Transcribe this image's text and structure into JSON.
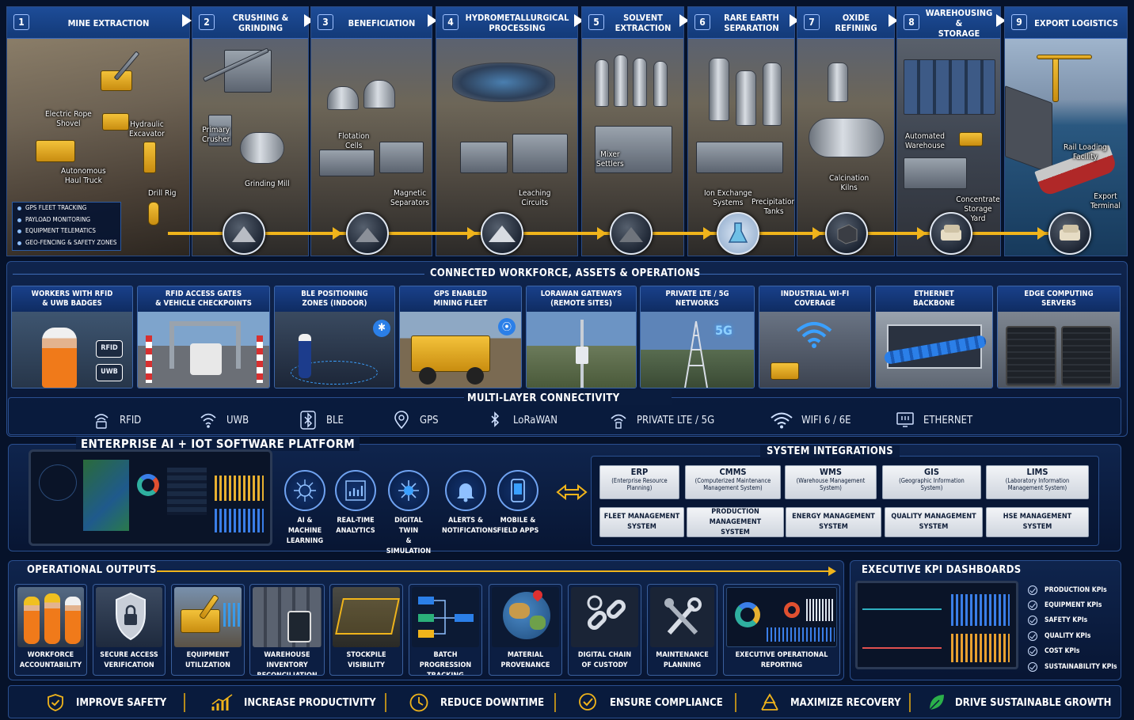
{
  "stages": [
    {
      "num": "1",
      "title": "MINE EXTRACTION",
      "labels": [
        "Electric Rope\nShovel",
        "Hydraulic\nExcavator",
        "Autonomous\nHaul Truck",
        "Drill Rig"
      ]
    },
    {
      "num": "2",
      "title": "CRUSHING &\nGRINDING",
      "labels": [
        "Primary\nCrusher",
        "Grinding Mill"
      ]
    },
    {
      "num": "3",
      "title": "BENEFICIATION",
      "labels": [
        "Flotation\nCells",
        "Magnetic\nSeparators"
      ]
    },
    {
      "num": "4",
      "title": "HYDROMETALLURGICAL\nPROCESSING",
      "labels": [
        "Leaching\nCircuits"
      ]
    },
    {
      "num": "5",
      "title": "SOLVENT\nEXTRACTION",
      "labels": [
        "Mixer\nSettlers"
      ]
    },
    {
      "num": "6",
      "title": "RARE EARTH\nSEPARATION",
      "labels": [
        "Ion Exchange\nSystems",
        "Precipitation\nTanks"
      ]
    },
    {
      "num": "7",
      "title": "OXIDE\nREFINING",
      "labels": [
        "Calcination\nKilns"
      ]
    },
    {
      "num": "8",
      "title": "WAREHOUSING &\nSTORAGE",
      "labels": [
        "Automated\nWarehouse",
        "Concentrate\nStorage Yard"
      ]
    },
    {
      "num": "9",
      "title": "EXPORT LOGISTICS",
      "labels": [
        "Rail Loading\nFacility",
        "Export\nTerminal"
      ]
    }
  ],
  "mine_features": [
    "GPS FLEET TRACKING",
    "PAYLOAD MONITORING",
    "EQUIPMENT TELEMATICS",
    "GEO-FENCING & SAFETY ZONES"
  ],
  "workforce": {
    "title": "CONNECTED WORKFORCE, ASSETS & OPERATIONS",
    "cards": [
      {
        "title": "WORKERS WITH RFID\n& UWB BADGES",
        "badges": [
          "RFID",
          "UWB"
        ]
      },
      {
        "title": "RFID ACCESS GATES\n& VEHICLE CHECKPOINTS"
      },
      {
        "title": "BLE POSITIONING\nZONES (INDOOR)"
      },
      {
        "title": "GPS ENABLED\nMINING FLEET"
      },
      {
        "title": "LORAWAN GATEWAYS\n(REMOTE SITES)"
      },
      {
        "title": "PRIVATE LTE / 5G\nNETWORKS",
        "badge": "5G"
      },
      {
        "title": "INDUSTRIAL WI-FI\nCOVERAGE"
      },
      {
        "title": "ETHERNET\nBACKBONE"
      },
      {
        "title": "EDGE COMPUTING\nSERVERS"
      }
    ]
  },
  "connectivity": {
    "title": "MULTI-LAYER CONNECTIVITY",
    "items": [
      {
        "label": "RFID",
        "icon": "rfid-icon"
      },
      {
        "label": "UWB",
        "icon": "uwb-icon"
      },
      {
        "label": "BLE",
        "icon": "bluetooth-icon"
      },
      {
        "label": "GPS",
        "icon": "location-pin-icon"
      },
      {
        "label": "LoRaWAN",
        "icon": "lorawan-icon"
      },
      {
        "label": "PRIVATE LTE / 5G",
        "icon": "cell-tower-icon"
      },
      {
        "label": "WIFI 6 / 6E",
        "icon": "wifi-icon"
      },
      {
        "label": "ETHERNET",
        "icon": "ethernet-icon"
      }
    ]
  },
  "platform": {
    "title": "ENTERPRISE AI + IOT SOFTWARE PLATFORM",
    "modules": [
      {
        "label": "AI & MACHINE\nLEARNING",
        "icon": "ai-brain-icon"
      },
      {
        "label": "REAL-TIME\nANALYTICS",
        "icon": "analytics-chart-icon"
      },
      {
        "label": "DIGITAL TWIN\n& SIMULATION",
        "icon": "digital-twin-icon"
      },
      {
        "label": "ALERTS &\nNOTIFICATIONS",
        "icon": "bell-icon"
      },
      {
        "label": "MOBILE &\nFIELD APPS",
        "icon": "mobile-phone-icon"
      }
    ]
  },
  "integrations": {
    "title": "SYSTEM INTEGRATIONS",
    "row1": [
      {
        "name": "ERP",
        "sub": "(Enterprise Resource\nPlanning)"
      },
      {
        "name": "CMMS",
        "sub": "(Computerized Maintenance\nManagement System)"
      },
      {
        "name": "WMS",
        "sub": "(Warehouse Management\nSystem)"
      },
      {
        "name": "GIS",
        "sub": "(Geographic Information\nSystem)"
      },
      {
        "name": "LIMS",
        "sub": "(Laboratory Information\nManagement System)"
      }
    ],
    "row2": [
      "FLEET MANAGEMENT\nSYSTEM",
      "PRODUCTION MANAGEMENT\nSYSTEM",
      "ENERGY MANAGEMENT\nSYSTEM",
      "QUALITY MANAGEMENT\nSYSTEM",
      "HSE MANAGEMENT\nSYSTEM"
    ]
  },
  "outputs": {
    "title": "OPERATIONAL OUTPUTS",
    "items": [
      "WORKFORCE\nACCOUNTABILITY",
      "SECURE ACCESS\nVERIFICATION",
      "EQUIPMENT\nUTILIZATION",
      "WAREHOUSE INVENTORY\nRECONCILIATION",
      "STOCKPILE\nVISIBILITY",
      "BATCH PROGRESSION\nTRACKING",
      "MATERIAL\nPROVENANCE",
      "DIGITAL CHAIN\nOF CUSTODY",
      "MAINTENANCE\nPLANNING",
      "EXECUTIVE OPERATIONAL\nREPORTING"
    ]
  },
  "kpi": {
    "title": "EXECUTIVE KPI DASHBOARDS",
    "items": [
      "PRODUCTION KPIs",
      "EQUIPMENT KPIs",
      "SAFETY KPIs",
      "QUALITY KPIs",
      "COST KPIs",
      "SUSTAINABILITY KPIs"
    ]
  },
  "benefits": [
    {
      "label": "IMPROVE SAFETY",
      "icon": "shield-check-icon"
    },
    {
      "label": "INCREASE PRODUCTIVITY",
      "icon": "bar-growth-icon"
    },
    {
      "label": "REDUCE DOWNTIME",
      "icon": "clock-icon"
    },
    {
      "label": "ENSURE COMPLIANCE",
      "icon": "badge-check-icon"
    },
    {
      "label": "MAXIMIZE RECOVERY",
      "icon": "recycle-icon"
    },
    {
      "label": "DRIVE SUSTAINABLE GROWTH",
      "icon": "leaf-icon"
    }
  ],
  "colors": {
    "accent": "#f0b41b",
    "panel": "#0d2450",
    "border": "#2a4f8f",
    "header": "#1d4c98"
  }
}
